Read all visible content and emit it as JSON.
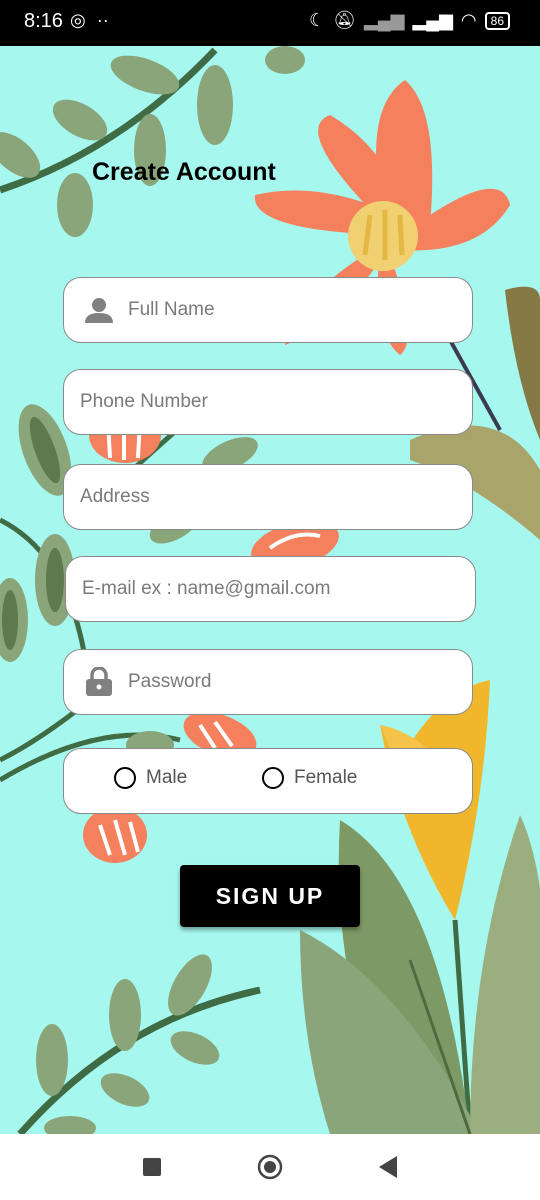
{
  "status_bar": {
    "time": "8:16",
    "left_icons": [
      "whatsapp-icon",
      "more-dots-icon"
    ],
    "right_icons": [
      "moon-icon",
      "mute-icon",
      "signal-icon",
      "signal-icon",
      "wifi-icon"
    ],
    "battery": "86"
  },
  "form": {
    "title": "Create Account",
    "full_name_placeholder": "Full Name",
    "phone_placeholder": "Phone Number",
    "address_placeholder": "Address",
    "email_placeholder": "E-mail ex : name@gmail.com",
    "password_placeholder": "Password",
    "gender_options": [
      "Male",
      "Female"
    ],
    "signup_label": "SIGN UP"
  },
  "colors": {
    "background": "#a6f8ee",
    "flower": "#f5805d",
    "leaf": "#8aa57a",
    "button": "#000000"
  },
  "nav_bar": [
    "recent-apps-icon",
    "home-icon",
    "back-icon"
  ]
}
